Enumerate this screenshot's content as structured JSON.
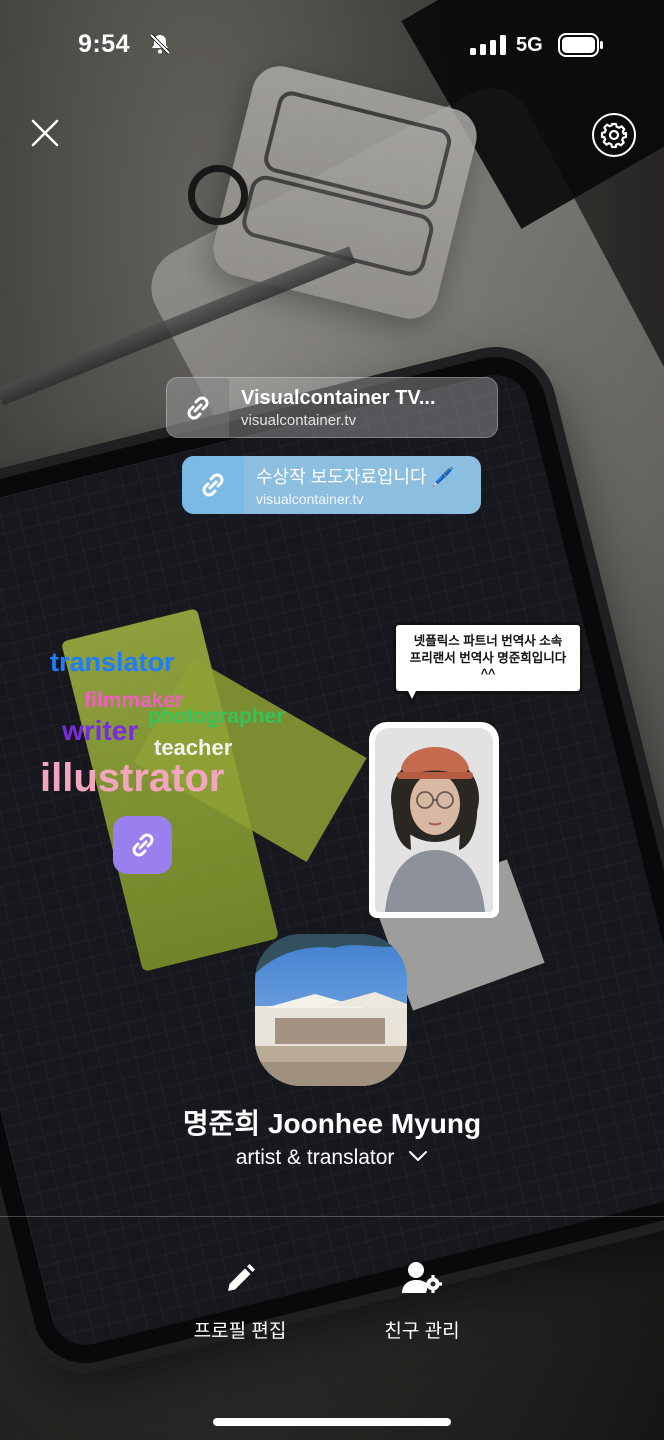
{
  "status_bar": {
    "time": "9:54",
    "network": "5G"
  },
  "links": [
    {
      "title": "Visualcontainer TV...",
      "url": "visualcontainer.tv"
    },
    {
      "title": "수상작 보도자료입니다 🖊️",
      "url": "visualcontainer.tv"
    }
  ],
  "stickers": {
    "words": [
      "translator",
      "filmmaker",
      "photographer",
      "writer",
      "teacher",
      "illustrator"
    ],
    "speech_bubble": "넷플릭스 파트너 번역사 소속\n프리랜서 번역사 명준희입니다\n^^"
  },
  "profile": {
    "name": "명준희 Joonhee Myung",
    "subtitle": "artist & translator"
  },
  "actions": {
    "edit_profile": "프로필 편집",
    "manage_friends": "친구 관리"
  },
  "colors": {
    "link_card_blue": "#96cdf0",
    "link_tile_purple": "#9a80ee",
    "word_translator": "#1e7cff",
    "word_filmmaker": "#f060c0",
    "word_photographer": "#35c45a",
    "word_writer": "#7a2be2",
    "word_illustrator": "#f3a5bd"
  },
  "icons": {
    "close": "close-icon",
    "settings": "gear-icon",
    "link": "link-icon",
    "edit": "pencil-icon",
    "friends": "person-gear-icon",
    "chevron": "chevron-down-icon",
    "mute": "bell-slash-icon"
  }
}
